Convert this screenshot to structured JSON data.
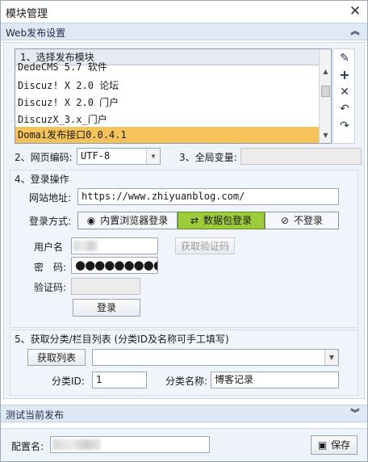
{
  "window": {
    "title": "模块管理",
    "close_icon": "✕"
  },
  "section_web": {
    "title": "Web发布设置",
    "collapse_icon": "chevron-double-up"
  },
  "module_list": {
    "header": "1、选择发布模块",
    "items": [
      "DedeCMS_5.7_软件",
      "Discuz! X 2.0 论坛",
      "Discuz! X 2.0 门户",
      "DiscuzX_3.x_门户",
      "Domai发布接口0.0.4.1"
    ],
    "selected_index": 4,
    "tools": [
      "pencil-icon",
      "plus-icon",
      "delete-x-icon",
      "undo-icon",
      "redo-icon"
    ]
  },
  "encoding": {
    "label": "2、网页编码:",
    "value": "UTF-8"
  },
  "global_var": {
    "label": "3、全局变量:",
    "value": ""
  },
  "login": {
    "title": "4、登录操作",
    "site_label": "网站地址:",
    "site_value": "https://www.zhiyuanblog.com/",
    "mode_label": "登录方式:",
    "modes": [
      "内置浏览器登录",
      "数据包登录",
      "不登录"
    ],
    "active_mode": 1,
    "username_label": "用户名",
    "password_label": "密　码:",
    "password_mask": "●●●●●●●●●●",
    "captcha_label": "验证码:",
    "get_captcha_label": "获取验证码",
    "login_button": "登录"
  },
  "categories": {
    "title": "5、获取分类/栏目列表 (分类ID及名称可手工填写)",
    "fetch_button": "获取列表",
    "id_label": "分类ID:",
    "id_value": "1",
    "name_label": "分类名称:",
    "name_value": "博客记录"
  },
  "section_test": {
    "title": "测试当前发布",
    "expand_icon": "chevron-double-down"
  },
  "footer": {
    "config_label": "配置名:",
    "save_label": "保存"
  }
}
